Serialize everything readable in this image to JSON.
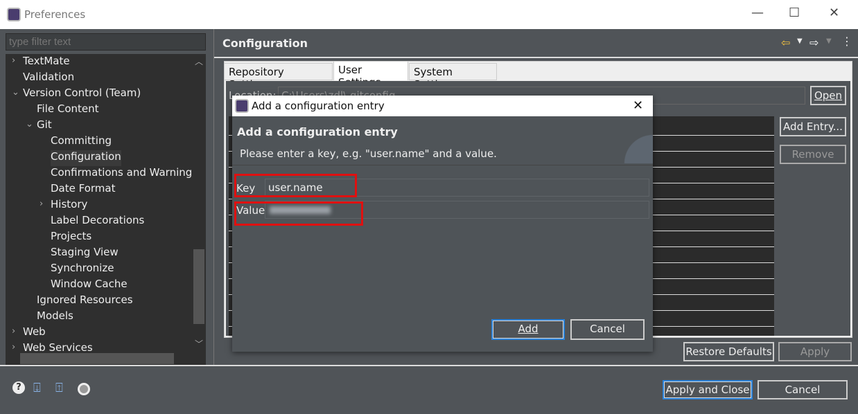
{
  "window": {
    "title": "Preferences",
    "minimize": "—",
    "maximize": "☐",
    "close": "✕"
  },
  "filter": {
    "placeholder": "type filter text"
  },
  "tree": [
    {
      "label": "TextMate",
      "level": 0,
      "chevron": "›"
    },
    {
      "label": "Validation",
      "level": 0,
      "chevron": ""
    },
    {
      "label": "Version Control (Team)",
      "level": 0,
      "chevron": "⌄"
    },
    {
      "label": "File Content",
      "level": 1,
      "chevron": ""
    },
    {
      "label": "Git",
      "level": 1,
      "chevron": "⌄"
    },
    {
      "label": "Committing",
      "level": 2,
      "chevron": ""
    },
    {
      "label": "Configuration",
      "level": 2,
      "chevron": "",
      "selected": true
    },
    {
      "label": "Confirmations and Warnings",
      "level": 2,
      "chevron": ""
    },
    {
      "label": "Date Format",
      "level": 2,
      "chevron": ""
    },
    {
      "label": "History",
      "level": 2,
      "chevron": "›"
    },
    {
      "label": "Label Decorations",
      "level": 2,
      "chevron": ""
    },
    {
      "label": "Projects",
      "level": 2,
      "chevron": ""
    },
    {
      "label": "Staging View",
      "level": 2,
      "chevron": ""
    },
    {
      "label": "Synchronize",
      "level": 2,
      "chevron": ""
    },
    {
      "label": "Window Cache",
      "level": 2,
      "chevron": ""
    },
    {
      "label": "Ignored Resources",
      "level": 1,
      "chevron": ""
    },
    {
      "label": "Models",
      "level": 1,
      "chevron": ""
    },
    {
      "label": "Web",
      "level": 0,
      "chevron": "›"
    },
    {
      "label": "Web Services",
      "level": 0,
      "chevron": "›"
    }
  ],
  "page": {
    "title": "Configuration"
  },
  "tabs": [
    {
      "label": "Repository Settings"
    },
    {
      "label": "User Settings",
      "active": true
    },
    {
      "label": "System Settings"
    }
  ],
  "location": {
    "label": "Location:",
    "value": "C:\\Users\\zdl\\.gitconfig"
  },
  "buttons": {
    "open": "Open",
    "add_entry": "Add Entry...",
    "remove": "Remove",
    "restore_defaults": "Restore Defaults",
    "apply": "Apply",
    "apply_and_close": "Apply and Close",
    "cancel": "Cancel"
  },
  "dialog": {
    "title": "Add a configuration entry",
    "heading": "Add a configuration entry",
    "description": "Please enter a key, e.g. \"user.name\" and a value.",
    "key_label": "Key",
    "key_value": "user.name",
    "value_label": "Value",
    "add": "Add",
    "cancel": "Cancel"
  },
  "colors": {
    "highlight": "#e01010",
    "default_button": "#2a82da"
  }
}
